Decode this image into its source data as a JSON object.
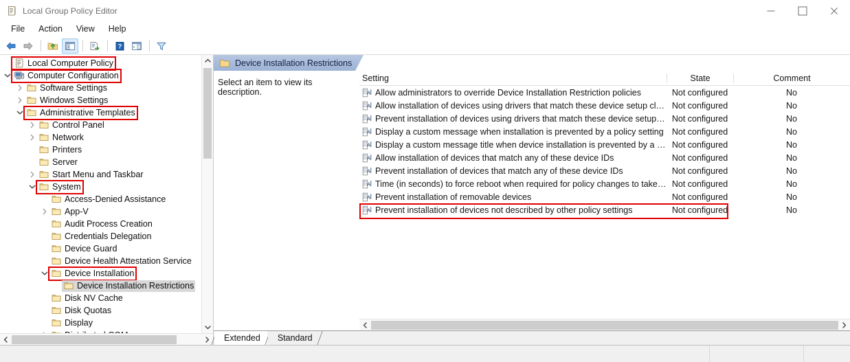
{
  "window": {
    "title": "Local Group Policy Editor",
    "icon": "policy-scroll-icon",
    "controls": {
      "minimize": "Minimize",
      "maximize": "Maximize",
      "close": "Close"
    }
  },
  "menu": {
    "items": [
      {
        "label": "File"
      },
      {
        "label": "Action"
      },
      {
        "label": "View"
      },
      {
        "label": "Help"
      }
    ]
  },
  "toolbar": {
    "buttons": [
      {
        "name": "back-arrow-icon",
        "label": "Back"
      },
      {
        "name": "forward-arrow-icon",
        "label": "Forward"
      },
      {
        "name": "up-one-level-icon",
        "label": "Up One Level"
      },
      {
        "name": "show-hide-console-tree-icon",
        "label": "Show/Hide Console Tree",
        "active": true
      },
      {
        "name": "export-list-icon",
        "label": "Export List"
      },
      {
        "name": "help-icon",
        "label": "Help"
      },
      {
        "name": "properties-icon",
        "label": "Properties"
      },
      {
        "name": "filter-icon",
        "label": "Filter"
      }
    ]
  },
  "tree": {
    "items": [
      {
        "label": "Local Computer Policy",
        "depth": 0,
        "chevron": "none",
        "icon": "policy-scroll-icon",
        "boxed": true,
        "selected": false
      },
      {
        "label": "Computer Configuration",
        "depth": 0,
        "chevron": "down",
        "icon": "computer-icon",
        "boxed": true,
        "selected": false
      },
      {
        "label": "Software Settings",
        "depth": 1,
        "chevron": "right",
        "icon": "folder-icon",
        "boxed": false,
        "selected": false
      },
      {
        "label": "Windows Settings",
        "depth": 1,
        "chevron": "right",
        "icon": "folder-icon",
        "boxed": false,
        "selected": false
      },
      {
        "label": "Administrative Templates",
        "depth": 1,
        "chevron": "down",
        "icon": "folder-icon",
        "boxed": true,
        "selected": false
      },
      {
        "label": "Control Panel",
        "depth": 2,
        "chevron": "right",
        "icon": "folder-icon",
        "boxed": false,
        "selected": false
      },
      {
        "label": "Network",
        "depth": 2,
        "chevron": "right",
        "icon": "folder-icon",
        "boxed": false,
        "selected": false
      },
      {
        "label": "Printers",
        "depth": 2,
        "chevron": "none",
        "icon": "folder-icon",
        "boxed": false,
        "selected": false
      },
      {
        "label": "Server",
        "depth": 2,
        "chevron": "none",
        "icon": "folder-icon",
        "boxed": false,
        "selected": false
      },
      {
        "label": "Start Menu and Taskbar",
        "depth": 2,
        "chevron": "right",
        "icon": "folder-icon",
        "boxed": false,
        "selected": false
      },
      {
        "label": "System",
        "depth": 2,
        "chevron": "down",
        "icon": "folder-icon",
        "boxed": true,
        "selected": false
      },
      {
        "label": "Access-Denied Assistance",
        "depth": 3,
        "chevron": "none",
        "icon": "folder-icon",
        "boxed": false,
        "selected": false
      },
      {
        "label": "App-V",
        "depth": 3,
        "chevron": "right",
        "icon": "folder-icon",
        "boxed": false,
        "selected": false
      },
      {
        "label": "Audit Process Creation",
        "depth": 3,
        "chevron": "none",
        "icon": "folder-icon",
        "boxed": false,
        "selected": false
      },
      {
        "label": "Credentials Delegation",
        "depth": 3,
        "chevron": "none",
        "icon": "folder-icon",
        "boxed": false,
        "selected": false
      },
      {
        "label": "Device Guard",
        "depth": 3,
        "chevron": "none",
        "icon": "folder-icon",
        "boxed": false,
        "selected": false
      },
      {
        "label": "Device Health Attestation Service",
        "depth": 3,
        "chevron": "none",
        "icon": "folder-icon",
        "boxed": false,
        "selected": false
      },
      {
        "label": "Device Installation",
        "depth": 3,
        "chevron": "down",
        "icon": "folder-icon",
        "boxed": true,
        "selected": false
      },
      {
        "label": "Device Installation Restrictions",
        "depth": 4,
        "chevron": "none",
        "icon": "folder-icon",
        "boxed": false,
        "selected": true
      },
      {
        "label": "Disk NV Cache",
        "depth": 3,
        "chevron": "none",
        "icon": "folder-icon",
        "boxed": false,
        "selected": false
      },
      {
        "label": "Disk Quotas",
        "depth": 3,
        "chevron": "none",
        "icon": "folder-icon",
        "boxed": false,
        "selected": false
      },
      {
        "label": "Display",
        "depth": 3,
        "chevron": "none",
        "icon": "folder-icon",
        "boxed": false,
        "selected": false
      },
      {
        "label": "Distributed COM",
        "depth": 3,
        "chevron": "right",
        "icon": "folder-icon",
        "boxed": false,
        "selected": false
      }
    ]
  },
  "right": {
    "header": {
      "title": "Device Installation Restrictions",
      "icon": "folder-icon"
    },
    "description": "Select an item to view its description.",
    "columns": {
      "setting": "Setting",
      "state": "State",
      "comment": "Comment"
    },
    "rows": [
      {
        "setting": "Allow administrators to override Device Installation Restriction policies",
        "state": "Not configured",
        "comment": "No",
        "highlight": false
      },
      {
        "setting": "Allow installation of devices using drivers that match these device setup class",
        "state": "Not configured",
        "comment": "No",
        "highlight": false
      },
      {
        "setting": "Prevent installation of devices using drivers that match these device setup cla...",
        "state": "Not configured",
        "comment": "No",
        "highlight": false
      },
      {
        "setting": "Display a custom message when installation is prevented by a policy setting",
        "state": "Not configured",
        "comment": "No",
        "highlight": false
      },
      {
        "setting": "Display a custom message title when device installation is prevented by a poli...",
        "state": "Not configured",
        "comment": "No",
        "highlight": false
      },
      {
        "setting": "Allow installation of devices that match any of these device IDs",
        "state": "Not configured",
        "comment": "No",
        "highlight": false
      },
      {
        "setting": "Prevent installation of devices that match any of these device IDs",
        "state": "Not configured",
        "comment": "No",
        "highlight": false
      },
      {
        "setting": "Time (in seconds) to force reboot when required for policy changes to take ef...",
        "state": "Not configured",
        "comment": "No",
        "highlight": false
      },
      {
        "setting": "Prevent installation of removable devices",
        "state": "Not configured",
        "comment": "No",
        "highlight": false
      },
      {
        "setting": "Prevent installation of devices not described by other policy settings",
        "state": "Not configured",
        "comment": "No",
        "highlight": true
      }
    ]
  },
  "tabs": {
    "items": [
      {
        "label": "Extended",
        "selected": true
      },
      {
        "label": "Standard",
        "selected": false
      }
    ]
  },
  "colors": {
    "highlight_red": "#e00000",
    "selection_gray": "#d8d8d8",
    "header_blue": "#a9bcdb"
  }
}
